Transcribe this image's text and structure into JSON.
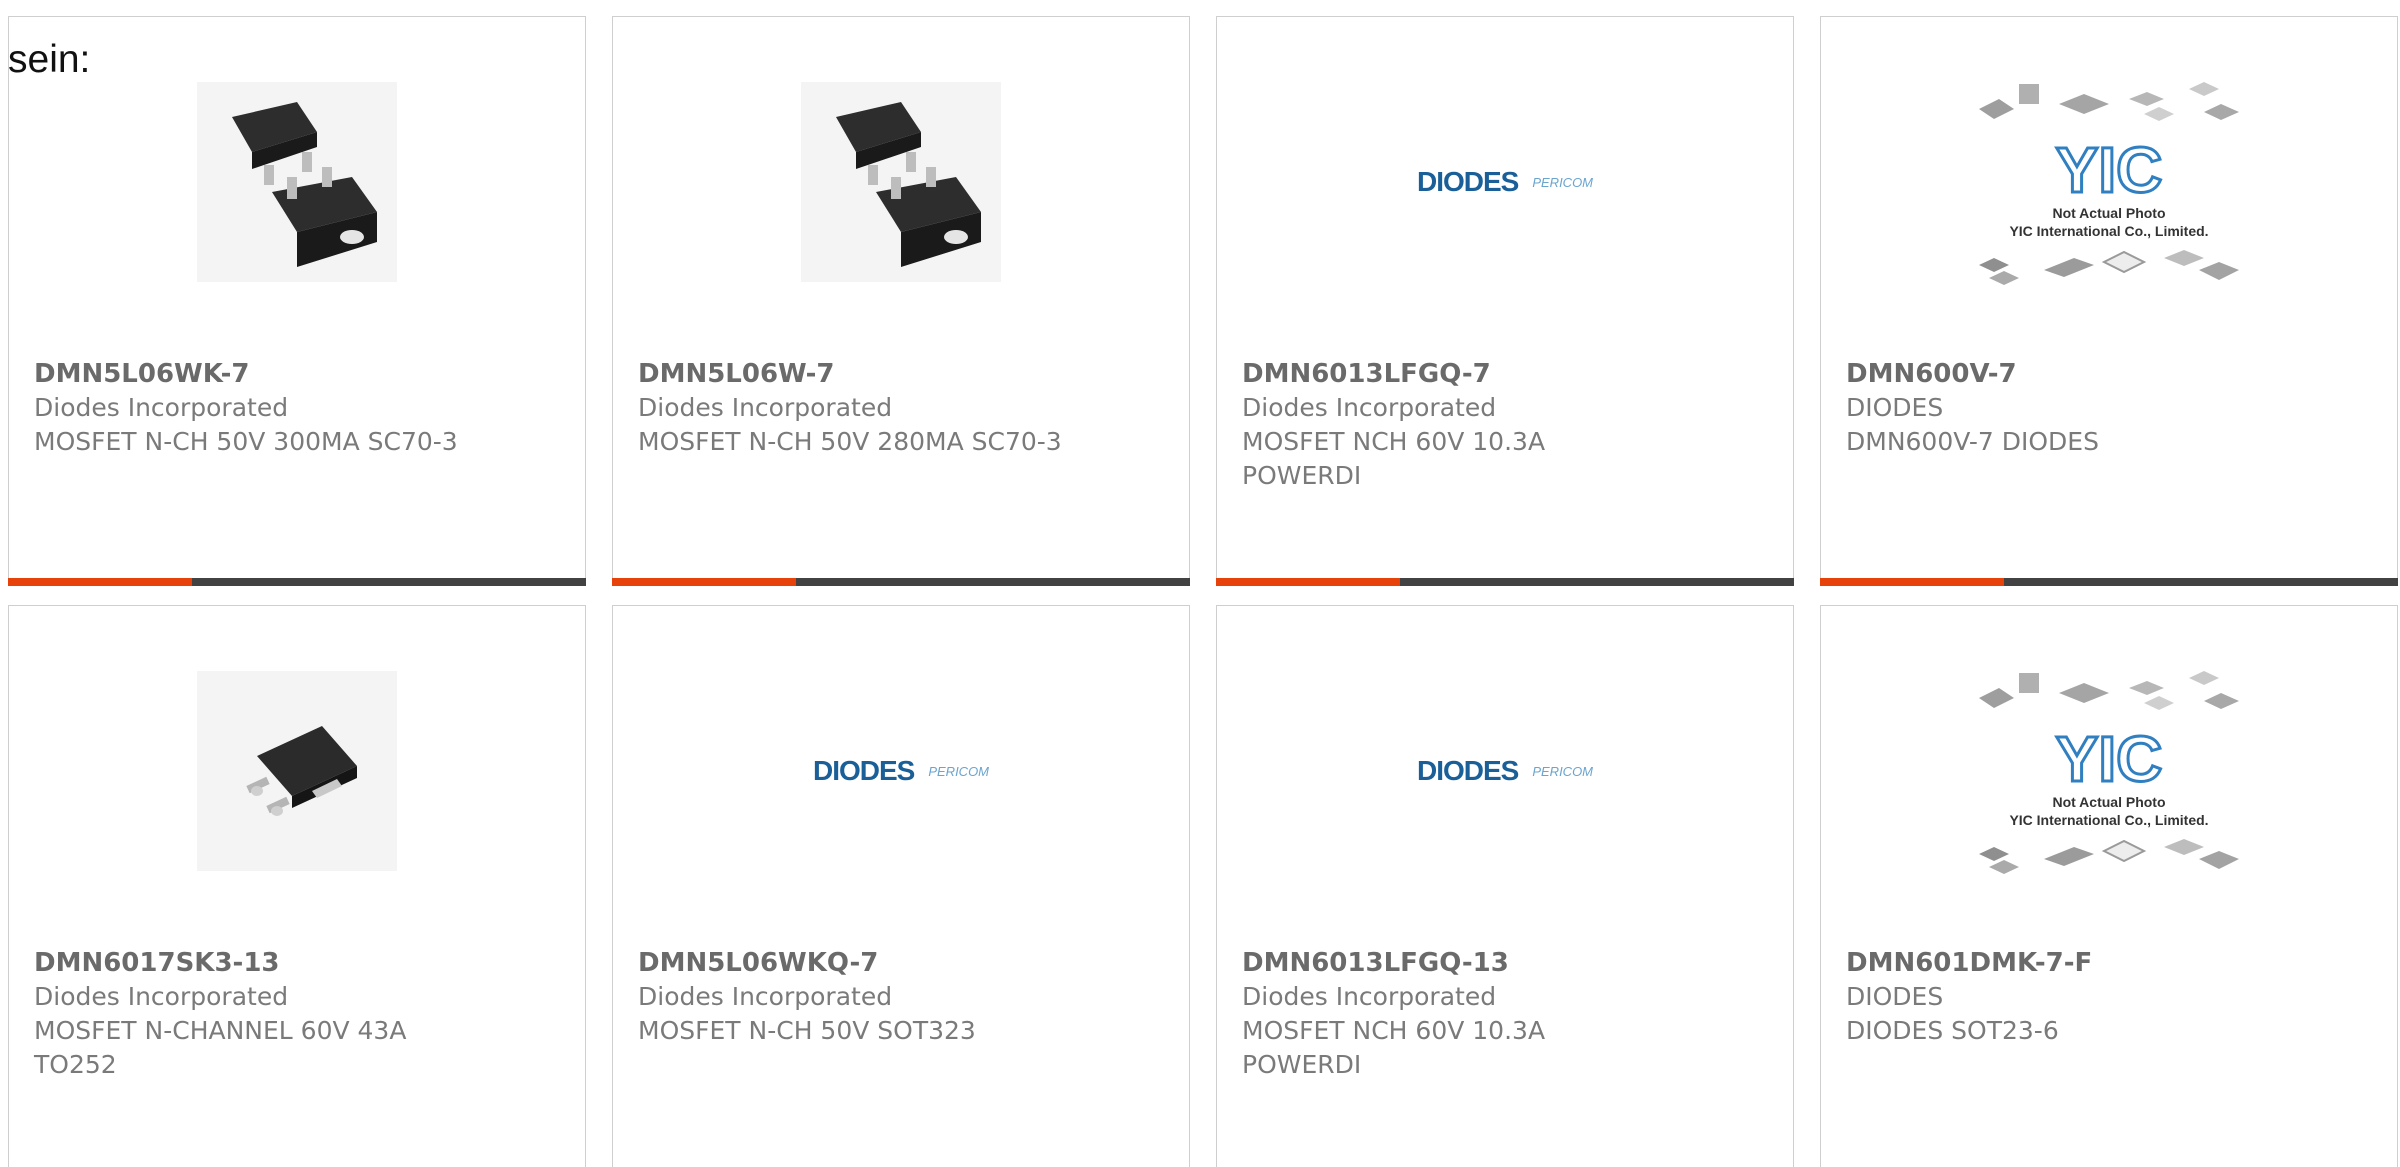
{
  "intro_text": "sein:",
  "colors": {
    "accent": "#e8420b",
    "bar": "#424242",
    "text": "#7a7a7a",
    "diodes_logo": "#1a5f98"
  },
  "products": [
    {
      "part_number": "DMN5L06WK-7",
      "manufacturer": "Diodes Incorporated",
      "description": "MOSFET N-CH 50V 300MA SC70-3",
      "image": "sot-chip-pair"
    },
    {
      "part_number": "DMN5L06W-7",
      "manufacturer": "Diodes Incorporated",
      "description": "MOSFET N-CH 50V 280MA SC70-3",
      "image": "sot-chip-pair"
    },
    {
      "part_number": "DMN6013LFGQ-7",
      "manufacturer": "Diodes Incorporated",
      "description": "MOSFET NCH 60V 10.3A POWERDI",
      "image": "diodes-logo"
    },
    {
      "part_number": "DMN600V-7",
      "manufacturer": "DIODES",
      "description": "DMN600V-7 DIODES",
      "image": "yic-placeholder"
    },
    {
      "part_number": "DMN6017SK3-13",
      "manufacturer": "Diodes Incorporated",
      "description": "MOSFET N-CHANNEL 60V 43A TO252",
      "image": "to252-chip"
    },
    {
      "part_number": "DMN5L06WKQ-7",
      "manufacturer": "Diodes Incorporated",
      "description": "MOSFET N-CH 50V SOT323",
      "image": "diodes-logo"
    },
    {
      "part_number": "DMN6013LFGQ-13",
      "manufacturer": "Diodes Incorporated",
      "description": "MOSFET NCH 60V 10.3A POWERDI",
      "image": "diodes-logo"
    },
    {
      "part_number": "DMN601DMK-7-F",
      "manufacturer": "DIODES",
      "description": "DIODES SOT23-6",
      "image": "yic-placeholder"
    }
  ],
  "logos": {
    "diodes": "DIODES",
    "pericom": "PERICOM"
  },
  "yic": {
    "mark": "YIC",
    "note_line1": "Not Actual Photo",
    "note_line2": "YIC International Co., Limited."
  }
}
